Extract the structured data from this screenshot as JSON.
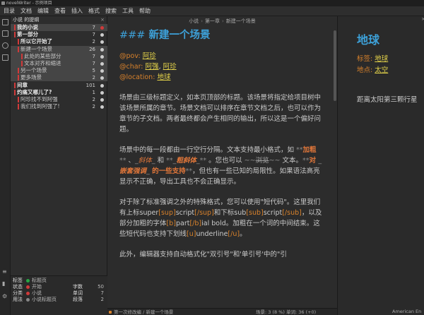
{
  "window": {
    "title": "novelWriter - 示例项目"
  },
  "menu": [
    "目录",
    "文档",
    "编辑",
    "查看",
    "插入",
    "格式",
    "搜索",
    "工具",
    "帮助"
  ],
  "outline": {
    "header": "小说 的提纲",
    "close": "×",
    "rows": [
      {
        "label": "我的小说",
        "count": "7",
        "indent": 0,
        "bold": true,
        "marker": "#d03a3a",
        "bar": "#d03a3a",
        "sel": true
      },
      {
        "label": "第一部分",
        "count": "7",
        "indent": 0,
        "bold": true,
        "marker": "#cccccc",
        "bar": "#d03a3a",
        "sel": false
      },
      {
        "label": "所以它开始了",
        "count": "2",
        "indent": 1,
        "bold": true,
        "marker": "#cccccc",
        "bar": "#d03a3a",
        "sel": false
      },
      {
        "label": "新建一个场景",
        "count": "26",
        "indent": 1,
        "bold": false,
        "marker": "#cccccc",
        "bar": "#d03a3a",
        "sel": true
      },
      {
        "label": "此处的某些部分",
        "count": "7",
        "indent": 2,
        "bold": false,
        "marker": "#cccccc",
        "bar": "#d03a3a",
        "sel": true
      },
      {
        "label": "文本对齐和缩进",
        "count": "7",
        "indent": 2,
        "bold": false,
        "marker": "#cccccc",
        "bar": "#d03a3a",
        "sel": true
      },
      {
        "label": "另一个场景",
        "count": "5",
        "indent": 1,
        "bold": false,
        "marker": "#cccccc",
        "bar": "#d03a3a",
        "sel": true
      },
      {
        "label": "更多场景",
        "count": "2",
        "indent": 1,
        "bold": false,
        "marker": "#cccccc",
        "bar": "#d03a3a",
        "sel": true
      },
      {
        "label": "间章",
        "count": "101",
        "indent": 0,
        "bold": true,
        "marker": "#cccccc",
        "bar": "#d03a3a",
        "sel": false
      },
      {
        "label": "灼痛又哪儿了?",
        "count": "1",
        "indent": 0,
        "bold": true,
        "marker": "#cccccc",
        "bar": "#d03a3a",
        "sel": false
      },
      {
        "label": "阿珍找不到阿强",
        "count": "2",
        "indent": 1,
        "bold": false,
        "marker": "#cccccc",
        "bar": "#d03a3a",
        "sel": false
      },
      {
        "label": "我们找到阿强了!",
        "count": "2",
        "indent": 1,
        "bold": false,
        "marker": "#cccccc",
        "bar": "#d03a3a",
        "sel": false
      }
    ]
  },
  "props": {
    "rows": [
      {
        "label": "标签",
        "value": "标题页",
        "dot": "#27a844"
      },
      {
        "label": "状态",
        "value": "开始",
        "dot": "#d03a3a"
      },
      {
        "label": "分类",
        "value": "小说",
        "dot": "#d03a3a"
      },
      {
        "label": "用法",
        "value": "小说标题页",
        "dot": "#888888"
      }
    ],
    "stats": [
      {
        "label": "字数",
        "value": "50"
      },
      {
        "label": "单词",
        "value": "7"
      },
      {
        "label": "段落",
        "value": "2"
      }
    ]
  },
  "editor": {
    "breadcrumb": [
      "小说",
      "第一章",
      "新建一个场景"
    ],
    "heading_hash": "###",
    "heading": "新建一个场景",
    "meta": [
      {
        "key": "@pov:",
        "vals": [
          "阿珍"
        ]
      },
      {
        "key": "@char:",
        "vals": [
          "阿强",
          "阿珍"
        ]
      },
      {
        "key": "@location:",
        "vals": [
          "地球"
        ]
      }
    ],
    "para1": "场景由三级标题定义，如本页顶部的标题。该场景将指定给项目树中该场景所属的章节。场景文档可以排序在章节文档之后，也可以作为章节的子文档。两者最终都会产生相同的输出，所以这是一个偏好问题。",
    "para2_a": "场景中的每一段都由一行空行分隔。文本支持最小格式，如 ",
    "para2_b_m1": "**",
    "para2_b": "加粗",
    "para2_b_m2": "**",
    "para2_c": " 、",
    "para2_i_m1": "_",
    "para2_i": "斜体",
    "para2_i_m2": "_",
    "para2_d": " 和 ",
    "para2_bi_m1": "**_",
    "para2_bi": "粗斜体",
    "para2_bi_m2": "_**",
    "para2_e": " 。您也可以 ",
    "para2_s_m1": "~~",
    "para2_s": "浏览",
    "para2_s_m2": "~~",
    "para2_f": " 文本。",
    "para2_n_m1": "**",
    "para2_n1": "对 ",
    "para2_n_m2": "_",
    "para2_n2": "嵌套强调",
    "para2_n_m3": "_",
    "para2_n3": " 的一些支持",
    "para2_n_m4": "**",
    "para2_g": "，但也有一些已知的局限性。如果语法高亮显示不正确，导出工具也不会正确显示。",
    "para3_a": "对于除了标准强调之外的特殊格式，您可以使用\"短代码\"。这里我们有上标super",
    "sc_sup1": "[sup]",
    "para3_b": "script",
    "sc_sup2": "[/sup]",
    "para3_c": "和下标sub",
    "sc_sub1": "[sub]",
    "para3_d": "script",
    "sc_sub2": "[/sub]",
    "para3_e": "，以及部分加粗的字体",
    "sc_b1": "[b]",
    "para3_f": "part",
    "sc_b2": "[/b]",
    "para3_g": "ial bold。加粗在一个词的中间结束。这些短代码也支持下划线",
    "sc_u1": "[u]",
    "para3_h": "underline",
    "sc_u2": "[/u]",
    "para3_i": "。",
    "para4": "此外，编辑器支持自动格式化\"双引号\"和'单引号'中的\"引",
    "status_left": "第一次修改编 / 新建一个场景",
    "status_right": "场景: 3 (8 %)   单词: 36 (+0)"
  },
  "viewer": {
    "title": "地球",
    "close": "×",
    "tags": [
      {
        "key": "标签:",
        "val": "地球"
      },
      {
        "key": "地点:",
        "val": "太空"
      }
    ],
    "desc": "距离太阳第三颗行星",
    "lang": "American En"
  }
}
